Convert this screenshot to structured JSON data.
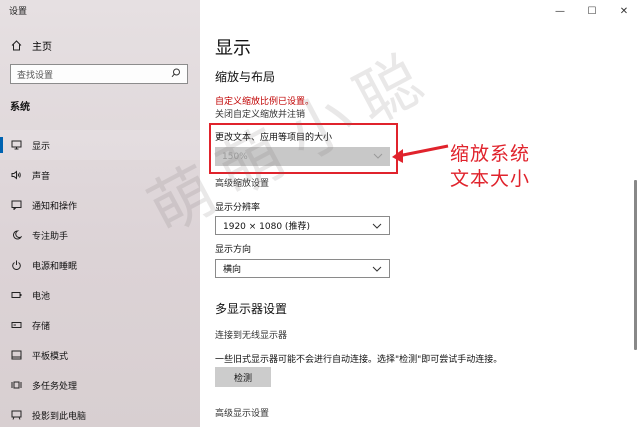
{
  "window": {
    "title": "设置",
    "controls": {
      "minimize": "—",
      "maximize": "☐",
      "close": "✕"
    }
  },
  "sidebar": {
    "home_label": "主页",
    "search_placeholder": "查找设置",
    "section_label": "系统",
    "items": [
      {
        "label": "显示",
        "icon": "monitor-icon",
        "active": true
      },
      {
        "label": "声音",
        "icon": "speaker-icon"
      },
      {
        "label": "通知和操作",
        "icon": "notification-icon"
      },
      {
        "label": "专注助手",
        "icon": "moon-icon"
      },
      {
        "label": "电源和睡眠",
        "icon": "power-icon"
      },
      {
        "label": "电池",
        "icon": "battery-icon"
      },
      {
        "label": "存储",
        "icon": "storage-icon"
      },
      {
        "label": "平板模式",
        "icon": "tablet-icon"
      },
      {
        "label": "多任务处理",
        "icon": "multitask-icon"
      },
      {
        "label": "投影到此电脑",
        "icon": "project-icon"
      }
    ]
  },
  "main": {
    "title": "显示",
    "scale_layout_heading": "缩放与布局",
    "custom_scale_link": "自定义缩放比例已设置。",
    "custom_scale_off_link": "关闭自定义缩放并注销",
    "change_size_label": "更改文本、应用等项目的大小",
    "change_size_value": "150%",
    "advanced_scaling_link": "高级缩放设置",
    "resolution_label": "显示分辨率",
    "resolution_value": "1920 × 1080 (推荐)",
    "orientation_label": "显示方向",
    "orientation_value": "横向",
    "multi_display_heading": "多显示器设置",
    "wireless_link": "连接到无线显示器",
    "detect_description": "一些旧式显示器可能不会进行自动连接。选择\"检测\"即可尝试手动连接。",
    "detect_button": "检测",
    "advanced_display_link": "高级显示设置"
  },
  "annotation": {
    "line1": "缩放系统",
    "line2": "文本大小",
    "color": "#e0232c"
  },
  "colors": {
    "accent": "#0063b1",
    "highlight_red": "#e0232c",
    "link_red": "#c00000"
  }
}
